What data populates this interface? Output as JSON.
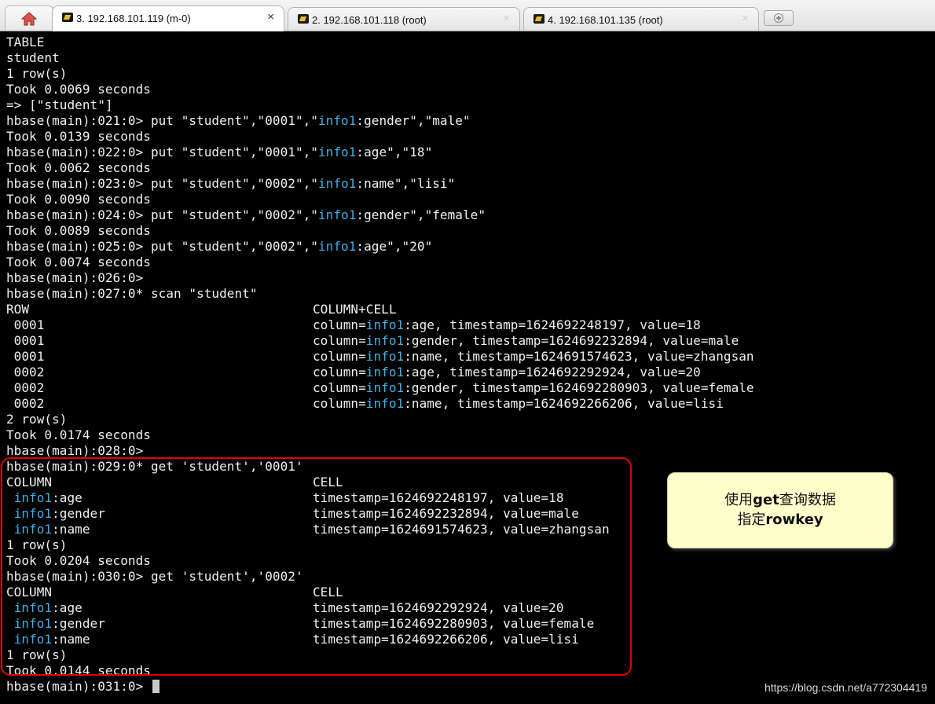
{
  "tabs": [
    {
      "label": "3. 192.168.101.119 (m-0)",
      "active": true
    },
    {
      "label": "2. 192.168.101.118 (root)",
      "active": false
    },
    {
      "label": "4. 192.168.101.135 (root)",
      "active": false
    }
  ],
  "close_glyph": "×",
  "icons": {
    "home": "home-icon",
    "tab": "putty-terminal-icon",
    "close": "close-icon",
    "new_tab": "new-tab-icon"
  },
  "colors": {
    "terminal_bg": "#000000",
    "terminal_text": "#f0f0f0",
    "keyword_highlight": "#3bb0e6",
    "annotation_border": "#e00000",
    "callout_bg": "#ffffcc"
  },
  "terminal": {
    "lines": [
      {
        "segments": [
          "TABLE"
        ]
      },
      {
        "segments": [
          "student"
        ]
      },
      {
        "segments": [
          "1 row(s)"
        ]
      },
      {
        "segments": [
          "Took 0.0069 seconds"
        ]
      },
      {
        "segments": [
          "=> [\"student\"]"
        ]
      },
      {
        "segments": [
          "hbase(main):021:0> put \"student\",\"0001\",\"",
          "info1",
          ":gender\",\"male\""
        ]
      },
      {
        "segments": [
          "Took 0.0139 seconds"
        ]
      },
      {
        "segments": [
          "hbase(main):022:0> put \"student\",\"0001\",\"",
          "info1",
          ":age\",\"18\""
        ]
      },
      {
        "segments": [
          "Took 0.0062 seconds"
        ]
      },
      {
        "segments": [
          "hbase(main):023:0> put \"student\",\"0002\",\"",
          "info1",
          ":name\",\"lisi\""
        ]
      },
      {
        "segments": [
          "Took 0.0090 seconds"
        ]
      },
      {
        "segments": [
          "hbase(main):024:0> put \"student\",\"0002\",\"",
          "info1",
          ":gender\",\"female\""
        ]
      },
      {
        "segments": [
          "Took 0.0089 seconds"
        ]
      },
      {
        "segments": [
          "hbase(main):025:0> put \"student\",\"0002\",\"",
          "info1",
          ":age\",\"20\""
        ]
      },
      {
        "segments": [
          "Took 0.0074 seconds"
        ]
      },
      {
        "segments": [
          "hbase(main):026:0>"
        ]
      },
      {
        "segments": [
          "hbase(main):027:0* scan \"student\""
        ]
      },
      {
        "left": "ROW",
        "right": [
          "COLUMN+CELL"
        ]
      },
      {
        "left": " 0001",
        "right": [
          "column=",
          "info1",
          ":age, timestamp=1624692248197, value=18"
        ]
      },
      {
        "left": " 0001",
        "right": [
          "column=",
          "info1",
          ":gender, timestamp=1624692232894, value=male"
        ]
      },
      {
        "left": " 0001",
        "right": [
          "column=",
          "info1",
          ":name, timestamp=1624691574623, value=zhangsan"
        ]
      },
      {
        "left": " 0002",
        "right": [
          "column=",
          "info1",
          ":age, timestamp=1624692292924, value=20"
        ]
      },
      {
        "left": " 0002",
        "right": [
          "column=",
          "info1",
          ":gender, timestamp=1624692280903, value=female"
        ]
      },
      {
        "left": " 0002",
        "right": [
          "column=",
          "info1",
          ":name, timestamp=1624692266206, value=lisi"
        ]
      },
      {
        "segments": [
          "2 row(s)"
        ]
      },
      {
        "segments": [
          "Took 0.0174 seconds"
        ]
      },
      {
        "segments": [
          "hbase(main):028:0>"
        ]
      },
      {
        "segments": [
          "hbase(main):029:0* get 'student','0001'"
        ]
      },
      {
        "left": "COLUMN",
        "right": [
          "CELL"
        ]
      },
      {
        "left": [
          " ",
          "info1",
          ":age"
        ],
        "right": [
          "timestamp=1624692248197, value=18"
        ]
      },
      {
        "left": [
          " ",
          "info1",
          ":gender"
        ],
        "right": [
          "timestamp=1624692232894, value=male"
        ]
      },
      {
        "left": [
          " ",
          "info1",
          ":name"
        ],
        "right": [
          "timestamp=1624691574623, value=zhangsan"
        ]
      },
      {
        "segments": [
          "1 row(s)"
        ]
      },
      {
        "segments": [
          "Took 0.0204 seconds"
        ]
      },
      {
        "segments": [
          "hbase(main):030:0> get 'student','0002'"
        ]
      },
      {
        "left": "COLUMN",
        "right": [
          "CELL"
        ]
      },
      {
        "left": [
          " ",
          "info1",
          ":age"
        ],
        "right": [
          "timestamp=1624692292924, value=20"
        ]
      },
      {
        "left": [
          " ",
          "info1",
          ":gender"
        ],
        "right": [
          "timestamp=1624692280903, value=female"
        ]
      },
      {
        "left": [
          " ",
          "info1",
          ":name"
        ],
        "right": [
          "timestamp=1624692266206, value=lisi"
        ]
      },
      {
        "segments": [
          "1 row(s)"
        ]
      },
      {
        "segments": [
          "Took 0.0144 seconds"
        ]
      },
      {
        "segments": [
          "hbase(main):031:0> "
        ],
        "cursor": true
      }
    ]
  },
  "callout": {
    "line1_prefix": "使用",
    "line1_bold": "get",
    "line1_suffix": "查询数据",
    "line2_prefix": "指定",
    "line2_bold": "rowkey"
  },
  "watermark": "https://blog.csdn.net/a772304419"
}
